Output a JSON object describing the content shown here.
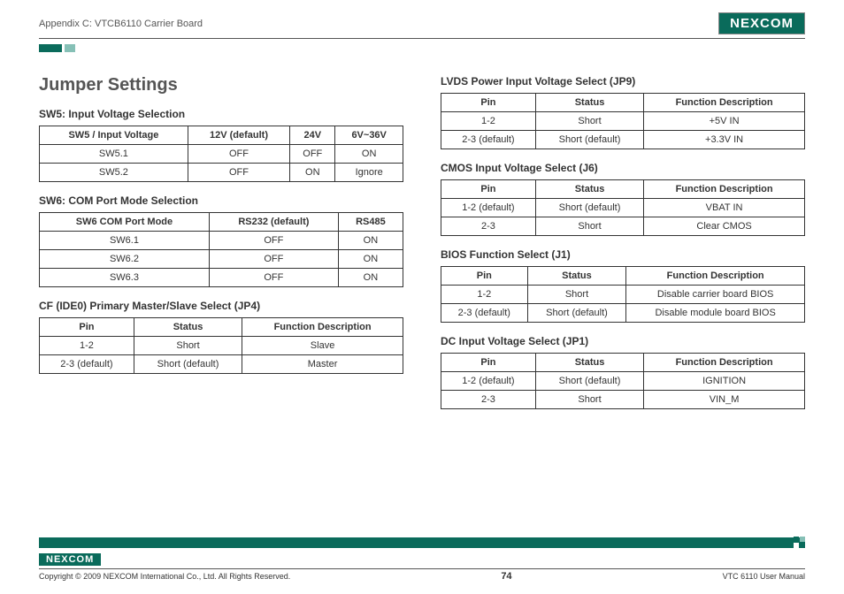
{
  "meta": {
    "appendix_label": "Appendix C: VTCB6110 Carrier Board",
    "brand": "NEXCOM",
    "page_title": "Jumper Settings"
  },
  "left": {
    "sw5": {
      "title": "SW5: Input Voltage Selection",
      "headers": [
        "SW5 / Input Voltage",
        "12V (default)",
        "24V",
        "6V~36V"
      ],
      "rows": [
        [
          "SW5.1",
          "OFF",
          "OFF",
          "ON"
        ],
        [
          "SW5.2",
          "OFF",
          "ON",
          "Ignore"
        ]
      ]
    },
    "sw6": {
      "title": "SW6: COM Port Mode Selection",
      "headers": [
        "SW6 COM Port Mode",
        "RS232 (default)",
        "RS485"
      ],
      "rows": [
        [
          "SW6.1",
          "OFF",
          "ON"
        ],
        [
          "SW6.2",
          "OFF",
          "ON"
        ],
        [
          "SW6.3",
          "OFF",
          "ON"
        ]
      ]
    },
    "jp4": {
      "title": "CF (IDE0) Primary Master/Slave Select (JP4)",
      "headers": [
        "Pin",
        "Status",
        "Function Description"
      ],
      "rows": [
        [
          "1-2",
          "Short",
          "Slave"
        ],
        [
          "2-3 (default)",
          "Short (default)",
          "Master"
        ]
      ]
    }
  },
  "right": {
    "jp9": {
      "title": "LVDS Power Input Voltage Select (JP9)",
      "headers": [
        "Pin",
        "Status",
        "Function Description"
      ],
      "rows": [
        [
          "1-2",
          "Short",
          "+5V IN"
        ],
        [
          "2-3 (default)",
          "Short (default)",
          "+3.3V IN"
        ]
      ]
    },
    "j6": {
      "title": "CMOS Input Voltage Select (J6)",
      "headers": [
        "Pin",
        "Status",
        "Function Description"
      ],
      "rows": [
        [
          "1-2 (default)",
          "Short (default)",
          "VBAT IN"
        ],
        [
          "2-3",
          "Short",
          "Clear CMOS"
        ]
      ]
    },
    "j1": {
      "title": "BIOS Function Select (J1)",
      "headers": [
        "Pin",
        "Status",
        "Function Description"
      ],
      "rows": [
        [
          "1-2",
          "Short",
          "Disable carrier board BIOS"
        ],
        [
          "2-3 (default)",
          "Short (default)",
          "Disable module board BIOS"
        ]
      ]
    },
    "jp1": {
      "title": "DC Input Voltage Select (JP1)",
      "headers": [
        "Pin",
        "Status",
        "Function Description"
      ],
      "rows": [
        [
          "1-2 (default)",
          "Short (default)",
          "IGNITION"
        ],
        [
          "2-3",
          "Short",
          "VIN_M"
        ]
      ]
    }
  },
  "footer": {
    "copyright": "Copyright © 2009 NEXCOM International Co., Ltd. All Rights Reserved.",
    "page": "74",
    "doc": "VTC 6110 User Manual"
  }
}
